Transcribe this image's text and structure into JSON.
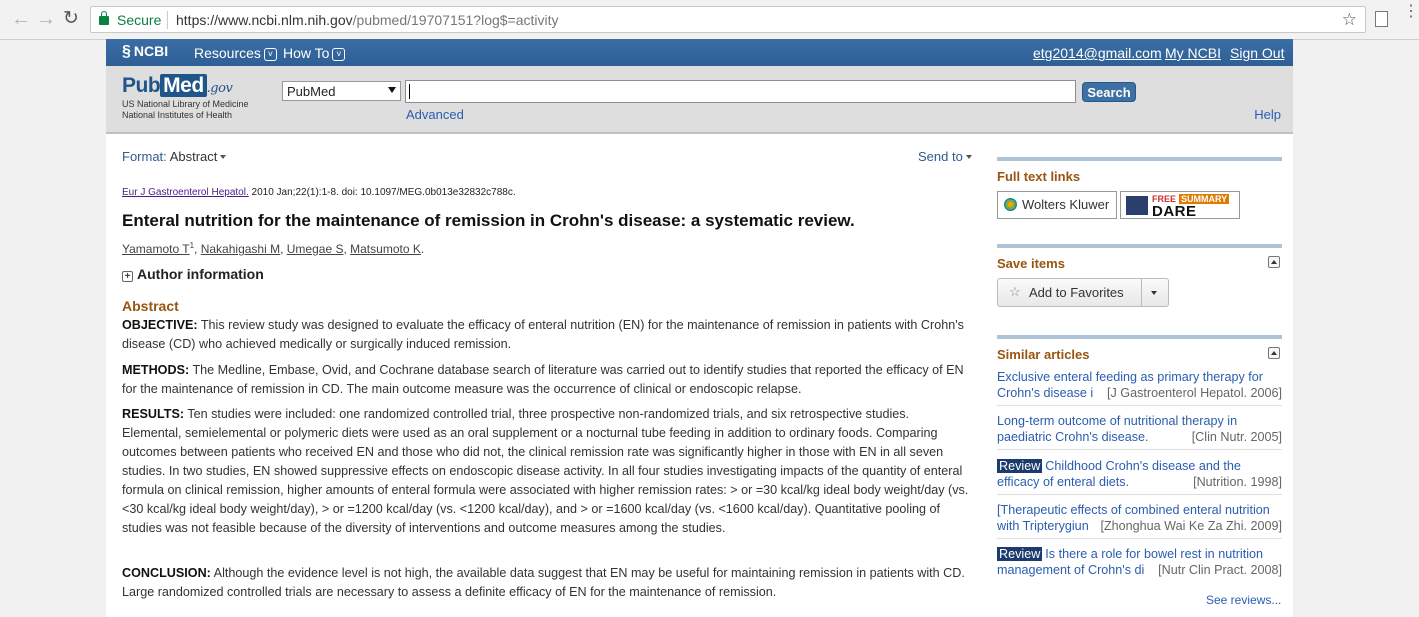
{
  "browser": {
    "secure_label": "Secure",
    "url_host": "https://www.ncbi.nlm.nih.gov",
    "url_path": "/pubmed/19707151?log$=activity"
  },
  "ncbi_bar": {
    "brand": "NCBI",
    "resources": "Resources",
    "howto": "How To",
    "email": "etg2014@gmail.com",
    "my_ncbi": "My NCBI",
    "sign_out": "Sign Out"
  },
  "search": {
    "logo_pub": "Pub",
    "logo_med": "Med",
    "logo_gov": ".gov",
    "logo_sub1": "US National Library of Medicine",
    "logo_sub2": "National Institutes of Health",
    "database": "PubMed",
    "query": "",
    "button": "Search",
    "advanced": "Advanced",
    "help": "Help"
  },
  "article": {
    "format_label": "Format:",
    "format_value": "Abstract",
    "send_to": "Send to",
    "journal": "Eur J Gastroenterol Hepatol.",
    "citation": "2010 Jan;22(1):1-8. doi: 10.1097/MEG.0b013e32832c788c.",
    "title": "Enteral nutrition for the maintenance of remission in Crohn's disease: a systematic review.",
    "authors": [
      "Yamamoto T",
      "Nakahigashi M",
      "Umegae S",
      "Matsumoto K"
    ],
    "author_sup": "1",
    "author_info": "Author information",
    "abstract_heading": "Abstract",
    "sections": [
      {
        "label": "OBJECTIVE:",
        "text": "This review study was designed to evaluate the efficacy of enteral nutrition (EN) for the maintenance of remission in patients with Crohn's disease (CD) who achieved medically or surgically induced remission."
      },
      {
        "label": "METHODS:",
        "text": "The Medline, Embase, Ovid, and Cochrane database search of literature was carried out to identify studies that reported the efficacy of EN for the maintenance of remission in CD. The main outcome measure was the occurrence of clinical or endoscopic relapse."
      },
      {
        "label": "RESULTS:",
        "text": "Ten studies were included: one randomized controlled trial, three prospective non-randomized trials, and six retrospective studies. Elemental, semielemental or polymeric diets were used as an oral supplement or a nocturnal tube feeding in addition to ordinary foods. Comparing outcomes between patients who received EN and those who did not, the clinical remission rate was significantly higher in those with EN in all seven studies. In two studies, EN showed suppressive effects on endoscopic disease activity. In all four studies investigating impacts of the quantity of enteral formula on clinical remission, higher amounts of enteral formula were associated with higher remission rates: > or =30 kcal/kg ideal body weight/day (vs. <30 kcal/kg ideal body weight/day), > or =1200 kcal/day (vs. <1200 kcal/day), and > or =1600 kcal/day (vs. <1600 kcal/day). Quantitative pooling of studies was not feasible because of the diversity of interventions and outcome measures among the studies."
      },
      {
        "label": "CONCLUSION:",
        "text": "Although the evidence level is not high, the available data suggest that EN may be useful for maintaining remission in patients with CD. Large randomized controlled trials are necessary to assess a definite efficacy of EN for the maintenance of remission."
      }
    ]
  },
  "sidebar": {
    "full_text_heading": "Full text links",
    "wolters": "Wolters Kluwer",
    "dare_free": "FREE",
    "dare_summary": "SUMMARY",
    "dare_word": "DARE",
    "save_heading": "Save items",
    "add_favorites": "Add to Favorites",
    "similar_heading": "Similar articles",
    "similar": [
      {
        "review": "",
        "line1": "Exclusive enteral feeding as primary therapy for",
        "line2": "Crohn's disease i",
        "source": "[J Gastroenterol Hepatol. 2006]"
      },
      {
        "review": "",
        "line1": "Long-term outcome of nutritional therapy in",
        "line2": "paediatric Crohn's disease.",
        "source": "[Clin Nutr. 2005]"
      },
      {
        "review": "Review",
        "line1": "Childhood Crohn's disease and the",
        "line2": "efficacy of enteral diets.",
        "source": "[Nutrition. 1998]"
      },
      {
        "review": "",
        "line1": "[Therapeutic effects of combined enteral nutrition",
        "line2": "with Tripterygiun",
        "source": "[Zhonghua Wai Ke Za Zhi. 2009]"
      },
      {
        "review": "Review",
        "line1": "Is there a role for bowel rest in nutrition",
        "line2": "management of Crohn's di",
        "source": "[Nutr Clin Pract. 2008]"
      }
    ],
    "see_reviews": "See reviews..."
  }
}
